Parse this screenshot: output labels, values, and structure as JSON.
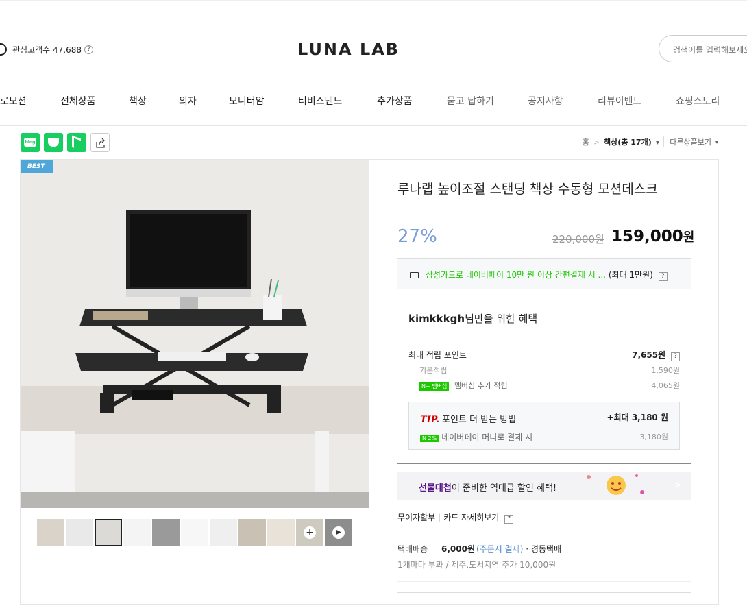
{
  "header": {
    "visitor_label": "관심고객수 47,688",
    "logo": "LUNA LAB",
    "search_placeholder": "검색어를 입력해보세요"
  },
  "nav": {
    "items": [
      "로모션",
      "전체상품",
      "책상",
      "의자",
      "모니터암",
      "티비스탠드",
      "추가상품",
      "묻고 답하기",
      "공지사항",
      "리뷰이벤트",
      "쇼핑스토리"
    ]
  },
  "share": {
    "blog_label": "blog"
  },
  "breadcrumb": {
    "home": "홈",
    "category": "책상(총 17개)",
    "more": "다른상품보기"
  },
  "product": {
    "badge": "BEST",
    "title": "루나랩 높이조절 스탠딩 책상 수동형 모션데스크",
    "discount": "27%",
    "original_price": "220,000원",
    "price": "159,000",
    "price_unit": "원"
  },
  "card_promo": {
    "highlight": "삼성카드로 네이버페이 10만 원 이상 간편결제 시 ...",
    "tail": "(최대 1만원)"
  },
  "benefits": {
    "user": "kimkkkgh",
    "title_suffix": "님만을 위한 혜택",
    "max_points_label": "최대 적립 포인트",
    "max_points_value": "7,655원",
    "basic_label": "기본적립",
    "basic_value": "1,590원",
    "membership_badge": "N+ 멤버십",
    "membership_label": "멤버십 추가 적립",
    "membership_value": "4,065원",
    "tip_label": "TIP.",
    "tip_text": "포인트 더 받는 방법",
    "tip_max": "+최대 3,180 원",
    "tip_pay_badge": "N 2%",
    "tip_pay_label": "네이버페이 머니로 결제 시",
    "tip_pay_value": "3,180원"
  },
  "banner": {
    "brand": "선물대첩",
    "text": "이 준비한 역대급 할인 혜택!"
  },
  "installment": {
    "left": "무이자할부",
    "right": "카드 자세히보기"
  },
  "shipping": {
    "label": "택배배송",
    "fee": "6,000원",
    "pay": "(주문시 결제)",
    "carrier": "· 경동택배",
    "note": "1개마다 부과 / 제주,도서지역 추가 10,000원"
  }
}
